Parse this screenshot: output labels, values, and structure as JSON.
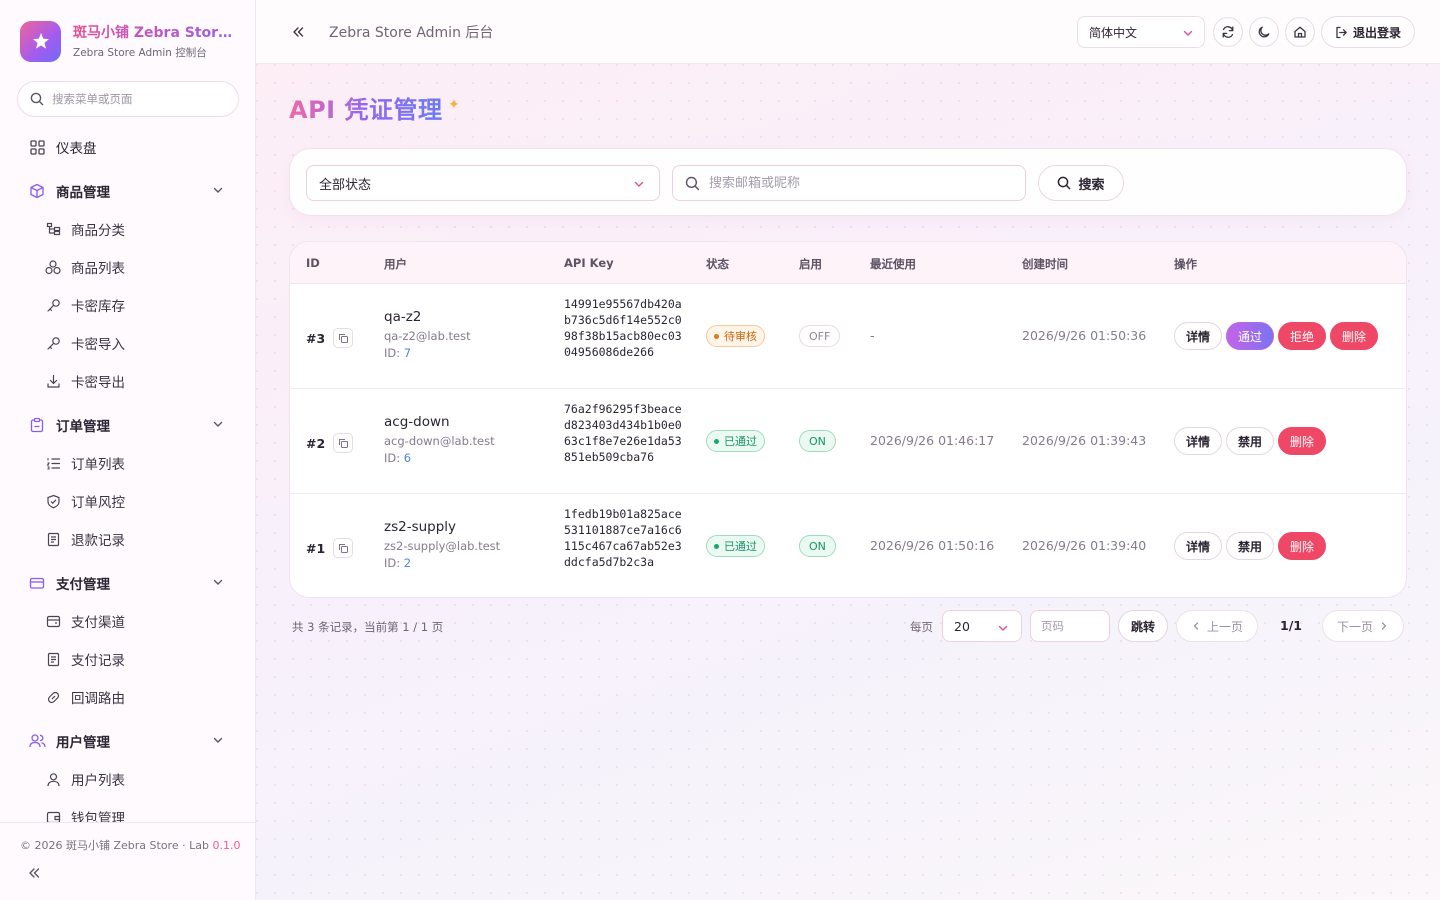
{
  "brand": {
    "title": "斑马小铺 Zebra Store Admin",
    "subtitle": "Zebra Store Admin 控制台",
    "logo_icon": "sparkle-star-icon",
    "logo_gradient": [
      "#f0649a",
      "#a15cf0",
      "#6f6cf5"
    ]
  },
  "sidebar": {
    "search_placeholder": "搜索菜单或页面",
    "dashboard": "仪表盘",
    "groups": [
      {
        "label": "商品管理",
        "icon": "box-icon",
        "items": [
          "商品分类",
          "商品列表",
          "卡密库存",
          "卡密导入",
          "卡密导出"
        ]
      },
      {
        "label": "订单管理",
        "icon": "clipboard-icon",
        "items": [
          "订单列表",
          "订单风控",
          "退款记录"
        ]
      },
      {
        "label": "支付管理",
        "icon": "credit-card-icon",
        "items": [
          "支付渠道",
          "支付记录",
          "回调路由"
        ]
      },
      {
        "label": "用户管理",
        "icon": "users-icon",
        "items": [
          "用户列表",
          "钱包管理"
        ]
      }
    ],
    "footer": {
      "copyright": "© 2026 斑马小铺 Zebra Store · Lab ",
      "version": "0.1.0"
    }
  },
  "header": {
    "title": "Zebra Store Admin 后台",
    "language": "简体中文",
    "logout": "退出登录"
  },
  "page": {
    "title": "API 凭证管理",
    "filter": {
      "status_value": "全部状态",
      "search_placeholder": "搜索邮箱或昵称",
      "search_button": "搜索"
    },
    "table": {
      "columns": [
        "ID",
        "用户",
        "API Key",
        "状态",
        "启用",
        "最近使用",
        "创建时间",
        "操作"
      ],
      "rows": [
        {
          "id": "#3",
          "name": "qa-z2",
          "email": "qa-z2@lab.test",
          "user_id_label": "ID: ",
          "user_id": "7",
          "api_key": "14991e95567db420ab736c5d6f14e552c098f38b15acb80ec0304956086de266",
          "status": "待审核",
          "status_type": "pending",
          "enabled": "OFF",
          "last_used": "-",
          "created": "2026/9/26 01:50:36",
          "actions": [
            "详情",
            "通过",
            "拒绝",
            "删除"
          ]
        },
        {
          "id": "#2",
          "name": "acg-down",
          "email": "acg-down@lab.test",
          "user_id_label": "ID: ",
          "user_id": "6",
          "api_key": "76a2f96295f3beaced823403d434b1b0e063c1f8e7e26e1da53851eb509cba76",
          "status": "已通过",
          "status_type": "approved",
          "enabled": "ON",
          "last_used": "2026/9/26 01:46:17",
          "created": "2026/9/26 01:39:43",
          "actions": [
            "详情",
            "禁用",
            "删除"
          ]
        },
        {
          "id": "#1",
          "name": "zs2-supply",
          "email": "zs2-supply@lab.test",
          "user_id_label": "ID: ",
          "user_id": "2",
          "api_key": "1fedb19b01a825ace531101887ce7a16c6115c467ca67ab52e3ddcfa5d7b2c3a",
          "status": "已通过",
          "status_type": "approved",
          "enabled": "ON",
          "last_used": "2026/9/26 01:50:16",
          "created": "2026/9/26 01:39:40",
          "actions": [
            "详情",
            "禁用",
            "删除"
          ]
        }
      ]
    },
    "pagination": {
      "info": "共 3 条记录，当前第 1 / 1 页",
      "per_page_label": "每页",
      "per_page": "20",
      "page_input_placeholder": "页码",
      "jump": "跳转",
      "prev": "上一页",
      "current": "1/1",
      "next": "下一页"
    }
  },
  "colors": {
    "accent_pink": "#ef69a6",
    "accent_purple": "#9467f0",
    "danger": "#ef4766",
    "success": "#179465",
    "warning": "#c9690e",
    "link": "#4c86e8"
  }
}
